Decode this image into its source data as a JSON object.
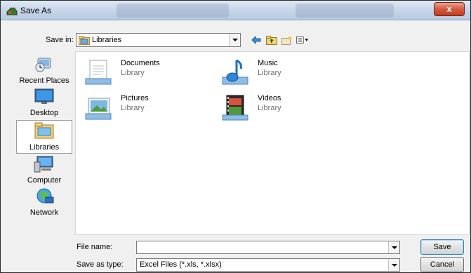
{
  "window": {
    "title": "Save As",
    "close_label": "x"
  },
  "toolbar": {
    "save_in_label": "Save in:",
    "save_in_value": "Libraries",
    "icons": [
      "back-arrow-icon",
      "up-folder-icon",
      "new-folder-icon",
      "view-menu-icon"
    ]
  },
  "places": [
    {
      "label": "Recent Places",
      "icon": "recent-places-icon"
    },
    {
      "label": "Desktop",
      "icon": "desktop-icon"
    },
    {
      "label": "Libraries",
      "icon": "libraries-icon",
      "selected": true
    },
    {
      "label": "Computer",
      "icon": "computer-icon"
    },
    {
      "label": "Network",
      "icon": "network-icon"
    }
  ],
  "items": [
    {
      "name": "Documents",
      "type": "Library",
      "icon": "documents-library-icon"
    },
    {
      "name": "Music",
      "type": "Library",
      "icon": "music-library-icon"
    },
    {
      "name": "Pictures",
      "type": "Library",
      "icon": "pictures-library-icon"
    },
    {
      "name": "Videos",
      "type": "Library",
      "icon": "videos-library-icon"
    }
  ],
  "form": {
    "file_name_label": "File name:",
    "file_name_value": "",
    "save_as_type_label": "Save as type:",
    "save_as_type_value": "Excel Files (*.xls, *.xlsx)"
  },
  "buttons": {
    "save": "Save",
    "cancel": "Cancel"
  }
}
